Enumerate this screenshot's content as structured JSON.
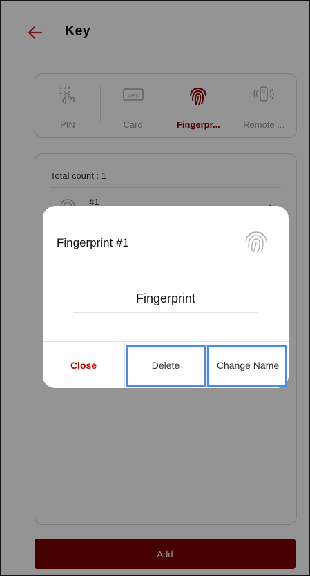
{
  "header": {
    "title": "Key",
    "back_icon": "back-arrow-icon"
  },
  "tabs": [
    {
      "label": "PIN",
      "icon": "pin-keypad-icon",
      "active": false
    },
    {
      "label": "Card",
      "icon": "card-icon",
      "active": false
    },
    {
      "label": "Fingerpr...",
      "icon": "fingerprint-icon",
      "active": true
    },
    {
      "label": "Remote ...",
      "icon": "remote-icon",
      "active": false
    }
  ],
  "list": {
    "count_text": "Total count : 1",
    "items": [
      {
        "label": "#1",
        "icon": "fingerprint-icon"
      }
    ]
  },
  "add_button": "Add",
  "dialog": {
    "title": "Fingerprint #1",
    "icon": "fingerprint-icon",
    "field_value": "Fingerprint",
    "buttons": {
      "close": "Close",
      "delete": "Delete",
      "change_name": "Change Name"
    }
  },
  "colors": {
    "accent": "#8b0000",
    "button_bg": "#7a0000",
    "close_text": "#c00000",
    "highlight": "#4a8de8"
  }
}
